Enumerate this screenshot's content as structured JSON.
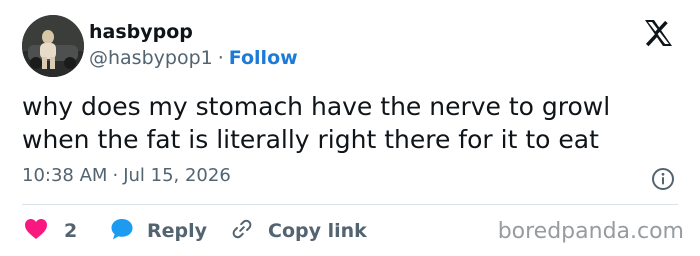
{
  "user": {
    "name": "hasbypop",
    "handle": "@hasbypop1",
    "separator": "·",
    "follow_label": "Follow"
  },
  "tweet": {
    "text": "why does my stomach have the nerve to growl when the fat is literally right there for it to eat",
    "time": "10:38 AM",
    "separator": "·",
    "date": "Jul 15, 2026"
  },
  "actions": {
    "like_count": "2",
    "reply_label": "Reply",
    "copy_label": "Copy link"
  },
  "watermark": "boredpanda.com",
  "colors": {
    "like": "#f91880",
    "reply": "#1d9bf0",
    "follow": "#1d7bd8",
    "muted": "#536471"
  },
  "icons": {
    "logo": "x-logo-icon",
    "info": "info-icon",
    "like": "heart-icon",
    "reply": "speech-bubble-icon",
    "copy": "link-icon"
  }
}
